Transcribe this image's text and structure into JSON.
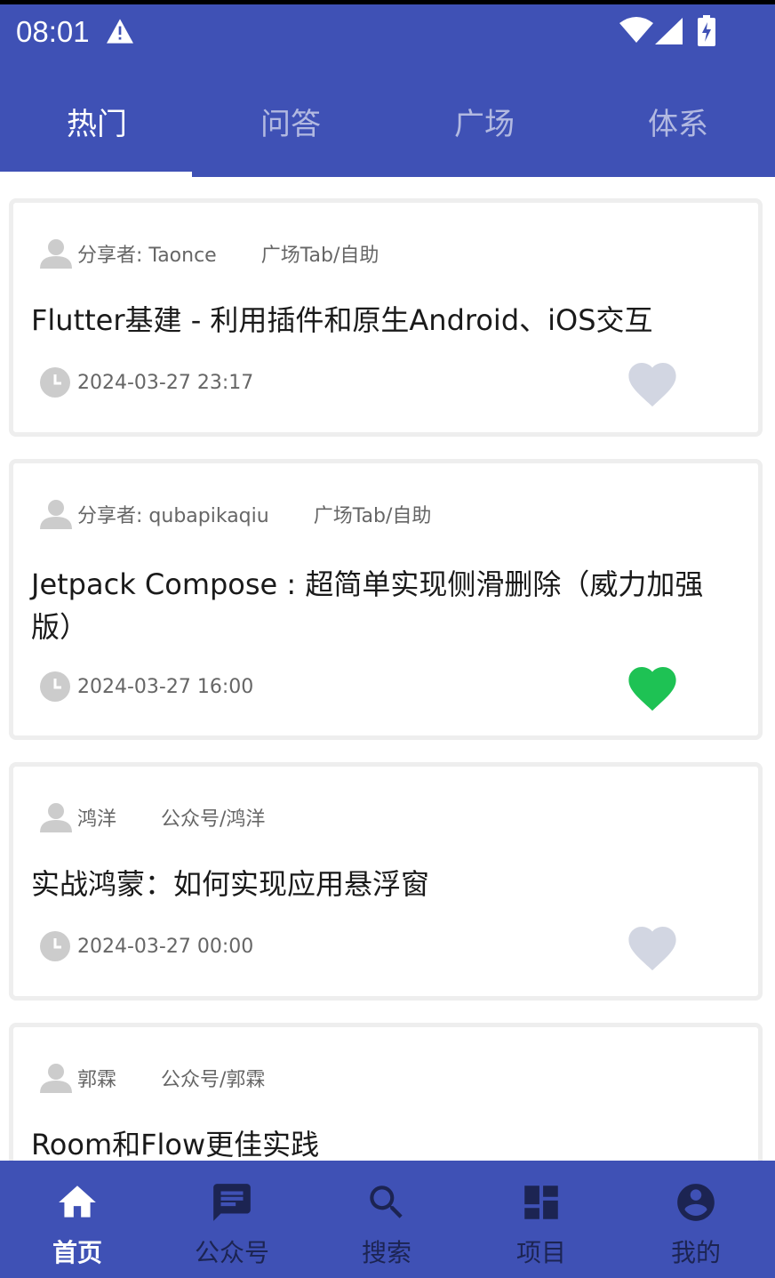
{
  "status_bar": {
    "time": "08:01",
    "icons": [
      "warning-icon",
      "wifi-icon",
      "signal-icon",
      "battery-charging-icon"
    ]
  },
  "tabs": [
    {
      "label": "热门",
      "active": true
    },
    {
      "label": "问答",
      "active": false
    },
    {
      "label": "广场",
      "active": false
    },
    {
      "label": "体系",
      "active": false
    }
  ],
  "articles": [
    {
      "author": "分享者: Taonce",
      "category": "广场Tab/自助",
      "title": "Flutter基建 - 利用插件和原生Android、iOS交互",
      "time": "2024-03-27 23:17",
      "liked": false
    },
    {
      "author": "分享者: qubapikaqiu",
      "category": "广场Tab/自助",
      "title": "Jetpack Compose : 超简单实现侧滑删除（威力加强版）",
      "time": "2024-03-27 16:00",
      "liked": true
    },
    {
      "author": "鸿洋",
      "category": "公众号/鸿洋",
      "title": "实战鸿蒙：如何实现应用悬浮窗",
      "time": "2024-03-27 00:00",
      "liked": false
    },
    {
      "author": "郭霖",
      "category": "公众号/郭霖",
      "title": "Room和Flow更佳实践",
      "time": "",
      "liked": false
    }
  ],
  "colors": {
    "primary": "#3f51b5",
    "liked": "#1ec254",
    "unliked": "#d2d6e2",
    "meta_icon": "#cccccc"
  },
  "bottom_nav": [
    {
      "label": "首页",
      "icon": "home-icon",
      "active": true
    },
    {
      "label": "公众号",
      "icon": "chat-icon",
      "active": false
    },
    {
      "label": "搜索",
      "icon": "search-icon",
      "active": false
    },
    {
      "label": "项目",
      "icon": "dashboard-icon",
      "active": false
    },
    {
      "label": "我的",
      "icon": "account-icon",
      "active": false
    }
  ]
}
